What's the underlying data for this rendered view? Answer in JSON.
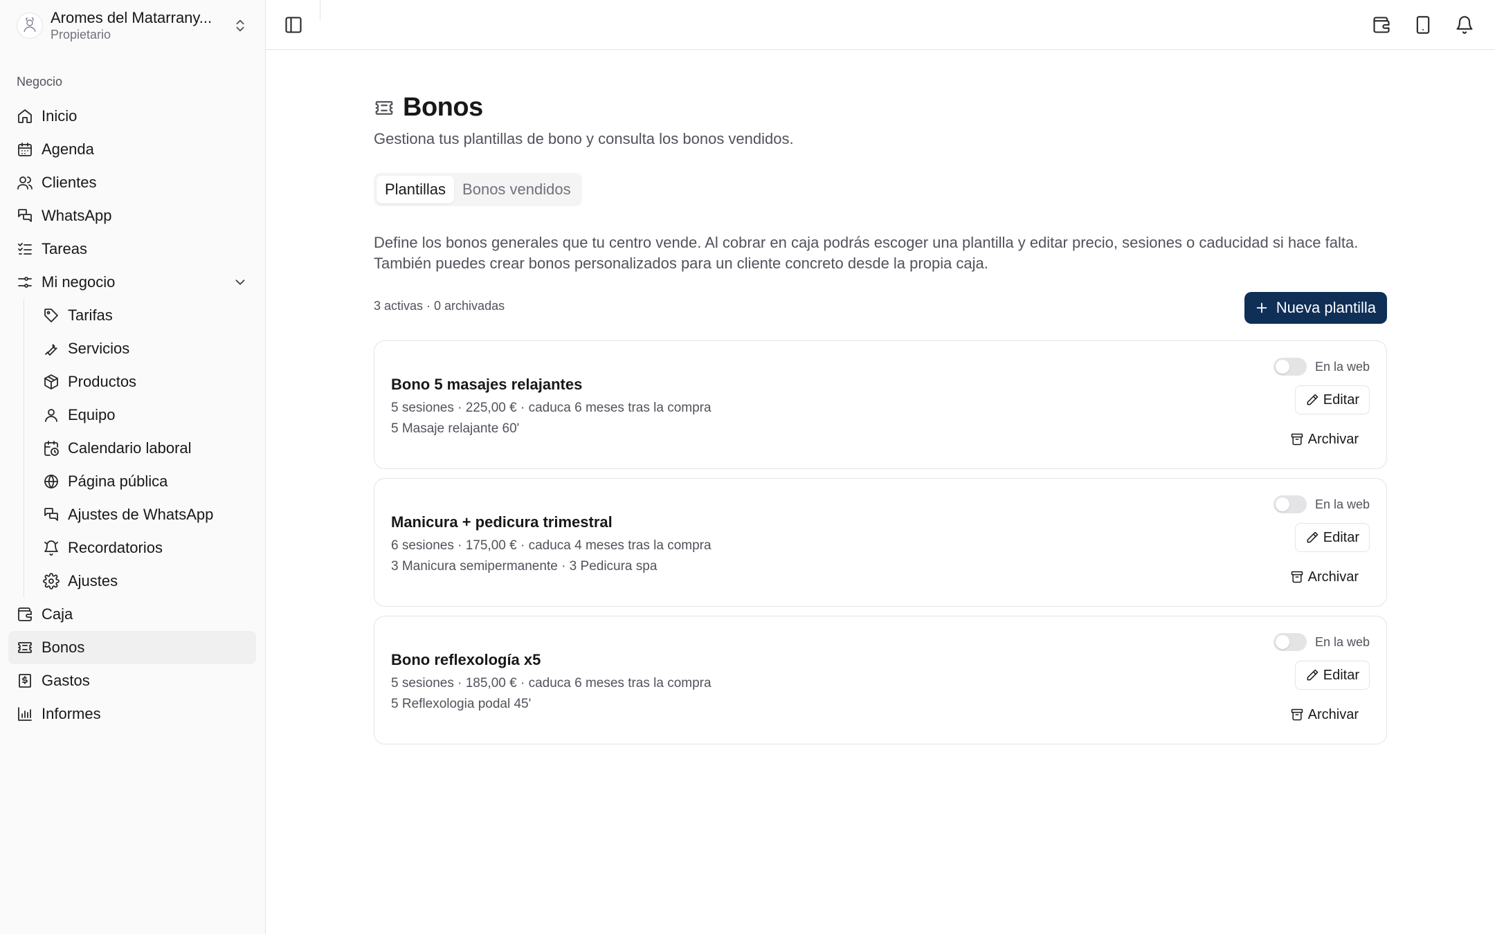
{
  "sidebar": {
    "org": {
      "name": "Aromes del Matarrany...",
      "role": "Propietario",
      "icon": "org-logo"
    },
    "group_label": "Negocio",
    "items": [
      {
        "label": "Inicio",
        "icon": "home-icon"
      },
      {
        "label": "Agenda",
        "icon": "calendar-icon"
      },
      {
        "label": "Clientes",
        "icon": "users-icon"
      },
      {
        "label": "WhatsApp",
        "icon": "chat-icon"
      },
      {
        "label": "Tareas",
        "icon": "task-list-icon"
      },
      {
        "label": "Mi negocio",
        "icon": "settings-sliders-icon",
        "expanded": true
      }
    ],
    "subitems": [
      {
        "label": "Tarifas",
        "icon": "tag-icon"
      },
      {
        "label": "Servicios",
        "icon": "wrench-icon"
      },
      {
        "label": "Productos",
        "icon": "package-icon"
      },
      {
        "label": "Equipo",
        "icon": "user-icon"
      },
      {
        "label": "Calendario laboral",
        "icon": "calendar-clock-icon"
      },
      {
        "label": "Página pública",
        "icon": "globe-icon"
      },
      {
        "label": "Ajustes de WhatsApp",
        "icon": "chat-icon"
      },
      {
        "label": "Recordatorios",
        "icon": "bell-icon"
      },
      {
        "label": "Ajustes",
        "icon": "gear-icon"
      }
    ],
    "bottom_items": [
      {
        "label": "Caja",
        "icon": "wallet-icon"
      },
      {
        "label": "Bonos",
        "icon": "ticket-icon",
        "active": true
      },
      {
        "label": "Gastos",
        "icon": "receipt-icon"
      },
      {
        "label": "Informes",
        "icon": "bar-chart-icon"
      }
    ]
  },
  "topbar": {
    "toggle_icon": "sidebar-toggle-icon",
    "actions": [
      "wallet-icon",
      "tablet-icon",
      "bell-icon"
    ]
  },
  "page": {
    "title": "Bonos",
    "subtitle": "Gestiona tus plantillas de bono y consulta los bonos vendidos.",
    "tabs": [
      {
        "label": "Plantillas",
        "active": true
      },
      {
        "label": "Bonos vendidos",
        "active": false
      }
    ],
    "intro_line1": "Define los bonos generales que tu centro vende. Al cobrar en caja podrás escoger una plantilla y editar precio, sesiones o caducidad si hace falta.",
    "intro_line2": "También puedes crear bonos personalizados para un cliente concreto desde la propia caja.",
    "counts": "3 activas · 0 archivadas",
    "new_button": "Nueva plantilla"
  },
  "cards": [
    {
      "name": "Bono 5 masajes relajantes",
      "meta": "5 sesiones · 225,00 € · caduca 6 meses tras la compra",
      "items": "5 Masaje relajante 60'",
      "web_label": "En la web",
      "web_on": false,
      "edit_label": "Editar",
      "archive_label": "Archivar"
    },
    {
      "name": "Manicura + pedicura trimestral",
      "meta": "6 sesiones · 175,00 € · caduca 4 meses tras la compra",
      "items": "3 Manicura semipermanente · 3 Pedicura spa",
      "web_label": "En la web",
      "web_on": false,
      "edit_label": "Editar",
      "archive_label": "Archivar"
    },
    {
      "name": "Bono reflexología x5",
      "meta": "5 sesiones · 185,00 € · caduca 6 meses tras la compra",
      "items": "5 Reflexologia podal 45'",
      "web_label": "En la web",
      "web_on": false,
      "edit_label": "Editar",
      "archive_label": "Archivar"
    }
  ],
  "colors": {
    "primary": "#0f2f57",
    "sidebar_bg": "#fafafa",
    "active_item_bg": "#f0f0f1",
    "border": "#e4e4e7",
    "muted_text": "#52525b"
  }
}
